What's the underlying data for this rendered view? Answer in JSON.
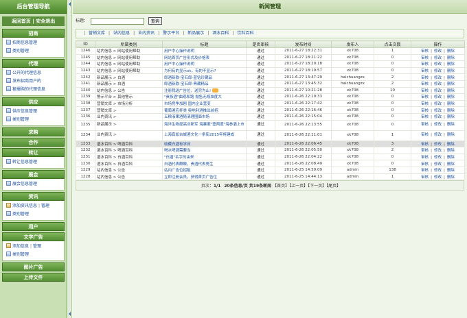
{
  "sidebar": {
    "title": "后台管理导航",
    "home": "返回首页",
    "separator": "|",
    "logout": "安全退出",
    "sections": [
      {
        "title": "招商",
        "items": [
          {
            "label": "招商信息管理"
          },
          {
            "label": "类别管理"
          }
        ]
      },
      {
        "title": "代理",
        "items": [
          {
            "label": "公开的代理信息"
          },
          {
            "label": "发布招商用户的"
          },
          {
            "label": "被撮购的代理信息"
          }
        ]
      },
      {
        "title": "供应",
        "items": [
          {
            "label": "供应信息管理"
          },
          {
            "label": "类别管理"
          }
        ]
      },
      {
        "title": "求购",
        "items": []
      },
      {
        "title": "合作",
        "items": []
      },
      {
        "title": "转让",
        "items": [
          {
            "label": "转让信息管理"
          }
        ]
      },
      {
        "title": "展会",
        "items": [
          {
            "label": "展会信息管理"
          }
        ]
      },
      {
        "title": "资讯",
        "items": [
          {
            "label": "添加资讯信息",
            "extra": "管理"
          },
          {
            "label": "类别管理"
          }
        ]
      },
      {
        "title": "用户",
        "items": []
      },
      {
        "title": "文字广告",
        "items": [
          {
            "label": "添加信息",
            "extra": "管理"
          },
          {
            "label": "类别管理"
          }
        ]
      },
      {
        "title": "图片广告",
        "items": []
      },
      {
        "title": "上传文件",
        "items": []
      }
    ]
  },
  "main": {
    "title": "新闻管理",
    "search": {
      "label": "标题：",
      "value": "",
      "button": "查询"
    },
    "tabs": [
      "营销文库",
      "站内信息",
      "业内资讯",
      "警示平台",
      "新品展示",
      "酒水百科",
      "饮料百科"
    ],
    "columns": [
      "ID",
      "所属类别",
      "标题",
      "是否审核",
      "发布时间",
      "发布人",
      "点击次数",
      "操作"
    ],
    "ops": [
      "审核",
      "修改",
      "删除"
    ],
    "rows": [
      {
        "id": "1246",
        "cat": "站内信息 > 网站使用帮助",
        "title": "用户中心操作说明",
        "status": "通过",
        "time": "2011-6-27 18:22:31",
        "user": "xk708",
        "clicks": "1"
      },
      {
        "id": "1245",
        "cat": "站内信息 > 网站使用帮助",
        "title": "网站首页广告形式及价格表",
        "status": "通过",
        "time": "2011-6-27 18:21:22",
        "user": "xk708",
        "clicks": "0"
      },
      {
        "id": "1244",
        "cat": "站内信息 > 网站使用帮助",
        "title": "用户中心操作说明",
        "status": "通过",
        "time": "2011-6-27 18:20:18",
        "user": "xk708",
        "clicks": "0"
      },
      {
        "id": "1243",
        "cat": "站内信息 > 网站使用帮助",
        "title": "为何有的显示ok，有的不显示?",
        "status": "通过",
        "time": "2011-6-27 18:19:57",
        "user": "xk708",
        "clicks": "0"
      },
      {
        "id": "1242",
        "cat": "新品展示 > 白酒",
        "title": "郎酒新款-宝石郎-蓝钻珍藏品",
        "status": "通过",
        "time": "2011-6-27 13:47:29",
        "user": "haichuangzx",
        "clicks": "2"
      },
      {
        "id": "1241",
        "cat": "新品展示 > 白酒",
        "title": "郎酒新款-宝石郎-典藏精品",
        "status": "通过",
        "time": "2011-6-27 13:45:32",
        "user": "haichuangzx",
        "clicks": "2"
      },
      {
        "id": "1240",
        "cat": "站内信息 > 公告",
        "title": "注册我送广告位，送完为止!",
        "status": "通过",
        "time": "2011-6-27 10:21:28",
        "user": "xk708",
        "clicks": "10",
        "emoji": true
      },
      {
        "id": "1239",
        "cat": "警示平台 > 其他警示",
        "title": "\"贵族酒\"曲观和路 抛售无规准度大",
        "status": "通过",
        "time": "2011-6-26 22:19:33",
        "user": "xk708",
        "clicks": "0"
      },
      {
        "id": "1238",
        "cat": "营销文库 > 市场分析",
        "title": "市场竞争加剧 国内企业营变",
        "status": "通过",
        "time": "2011-6-26 22:17:42",
        "user": "xk708",
        "clicks": "0"
      },
      {
        "id": "1237",
        "cat": "营销文库 >",
        "title": "葡萄酒应杯类 奥地利酒推出前招",
        "status": "通过",
        "time": "2011-6-26 22:16:46",
        "user": "xk708",
        "clicks": "0"
      },
      {
        "id": "1236",
        "cat": "业内资讯 >",
        "title": "五粮液果酒随清理围面市场",
        "status": "通过",
        "time": "2011-6-26 22:15:04",
        "user": "xk708",
        "clicks": "0"
      },
      {
        "id": "1235",
        "cat": "新品展示 >",
        "title": "海洋生物提高业新军 海暴麦\"壹两度\"海参酒上市",
        "status": "通过",
        "time": "2011-6-26 22:13:55",
        "user": "xk708",
        "clicks": "0",
        "tall": true
      },
      {
        "id": "1234",
        "cat": "业内资讯 >",
        "title": "上海真如古城酒文化一条街2015年将建成",
        "status": "通过",
        "time": "2011-6-26 22:11:01",
        "user": "xk708",
        "clicks": "1",
        "tall": true
      },
      {
        "id": "1233",
        "cat": "酒水百科 > 啤酒百科",
        "title": "收藏白酒有学问",
        "status": "通过",
        "time": "2011-6-26 22:06:45",
        "user": "xk708",
        "clicks": "3",
        "hl": true
      },
      {
        "id": "1232",
        "cat": "酒水百科 > 啤酒百科",
        "title": "喝冰啤酒需要当",
        "status": "通过",
        "time": "2011-6-26 22:05:50",
        "user": "xk708",
        "clicks": "2"
      },
      {
        "id": "1231",
        "cat": "酒水百科 > 白酒百科",
        "title": "\"白酒\"名字的由来",
        "status": "通过",
        "time": "2011-6-26 22:04:22",
        "user": "xk708",
        "clicks": "0"
      },
      {
        "id": "1230",
        "cat": "酒水百科 > 白酒百科",
        "title": "白酒代表酿酿，贵酒代表男生",
        "status": "通过",
        "time": "2011-6-26 22:08:49",
        "user": "xk708",
        "clicks": "0"
      },
      {
        "id": "1229",
        "cat": "站内信息 > 公告",
        "title": "站内广告位招租",
        "status": "通过",
        "time": "2011-6-25 14:59:09",
        "user": "admin",
        "clicks": "138"
      },
      {
        "id": "1228",
        "cat": "站内信息 > 公告",
        "title": "立即注册会员，获得首页广告位",
        "status": "通过",
        "time": "2011-6-25 14:44:13",
        "user": "admin",
        "clicks": "1"
      }
    ],
    "pager": {
      "page_label": "页次：",
      "page_value": "1/1",
      "per_page": "20条信息/页",
      "total": "共19条新闻",
      "first": "【首页】",
      "prev": "【上一页】",
      "next": "【下一页】",
      "last": "【尾页】"
    }
  }
}
